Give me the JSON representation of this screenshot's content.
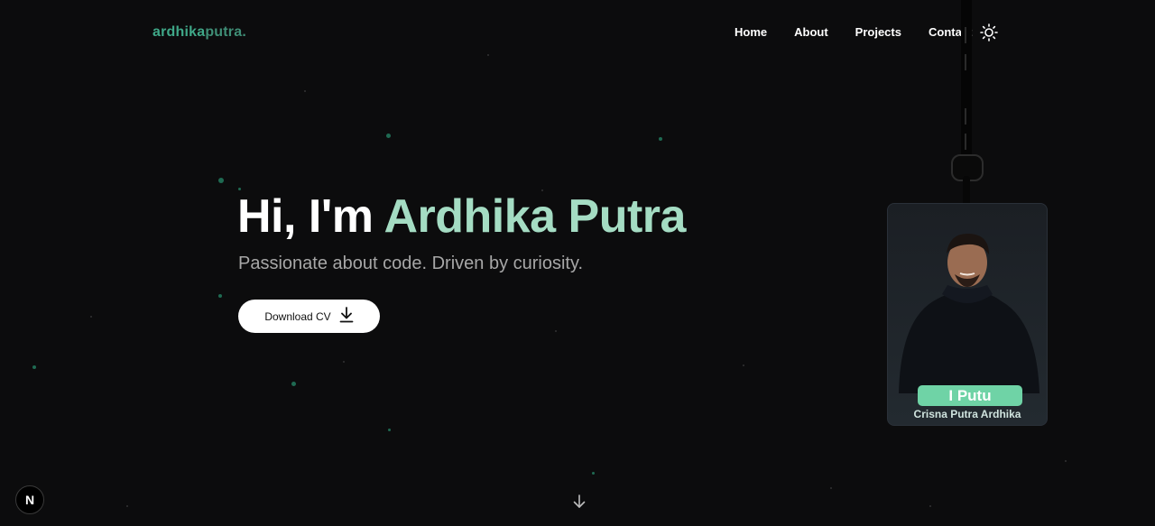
{
  "brand": {
    "logo_part1": "ardhika",
    "logo_part2": "putra."
  },
  "nav": {
    "items": [
      "Home",
      "About",
      "Projects",
      "Contact"
    ]
  },
  "theme_toggle_icon": "sun-icon",
  "hero": {
    "greeting": "Hi, I'm ",
    "name": "Ardhika Putra",
    "subtitle": "Passionate about code. Driven by curiosity.",
    "cta_label": "Download CV",
    "cta_icon": "download-icon"
  },
  "id_card": {
    "short_name": "I Putu",
    "full_name": "Crisna Putra Ardhika"
  },
  "scroll_icon": "arrow-down-icon",
  "framework_badge": "N",
  "colors": {
    "background": "#0c0c0d",
    "accent": "#a4dcc3",
    "logo": "#3fa888",
    "badge_pill": "#6fd3a6"
  }
}
